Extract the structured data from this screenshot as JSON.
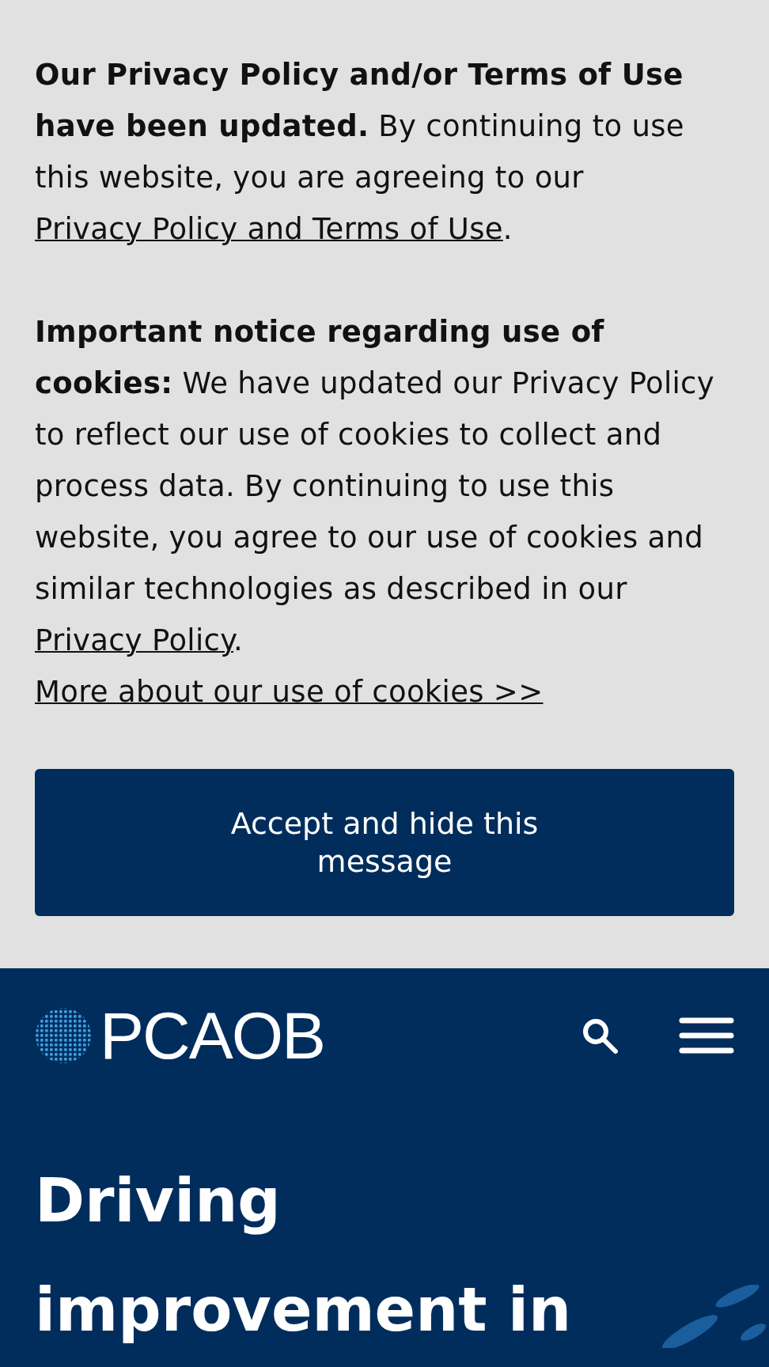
{
  "cookie_banner": {
    "paragraphs": [
      [
        {
          "kind": "text",
          "text": "**Our Privacy Policy and/or Terms of Use have been updated.** By continuing to use this website, you are agreeing to our "
        },
        {
          "kind": "link",
          "text": "Privacy Policy and Terms of Use"
        },
        {
          "kind": "text",
          "text": "."
        }
      ],
      [
        {
          "kind": "text",
          "text": "**Important notice regarding use of cookies:** We have updated our Privacy Policy to reflect our use of cookies to collect and process data. By continuing to use this website, you agree to our use of cookies and similar technologies as described in our "
        },
        {
          "kind": "link",
          "text": "Privacy Policy"
        },
        {
          "kind": "text",
          "text": ". "
        },
        {
          "kind": "link",
          "text": "More about our use of cookies >>"
        }
      ]
    ],
    "button": "Accept and hide this message"
  },
  "header": {
    "logo": "PCAOB"
  },
  "hero": {
    "headline": "Driving improvement in"
  }
}
